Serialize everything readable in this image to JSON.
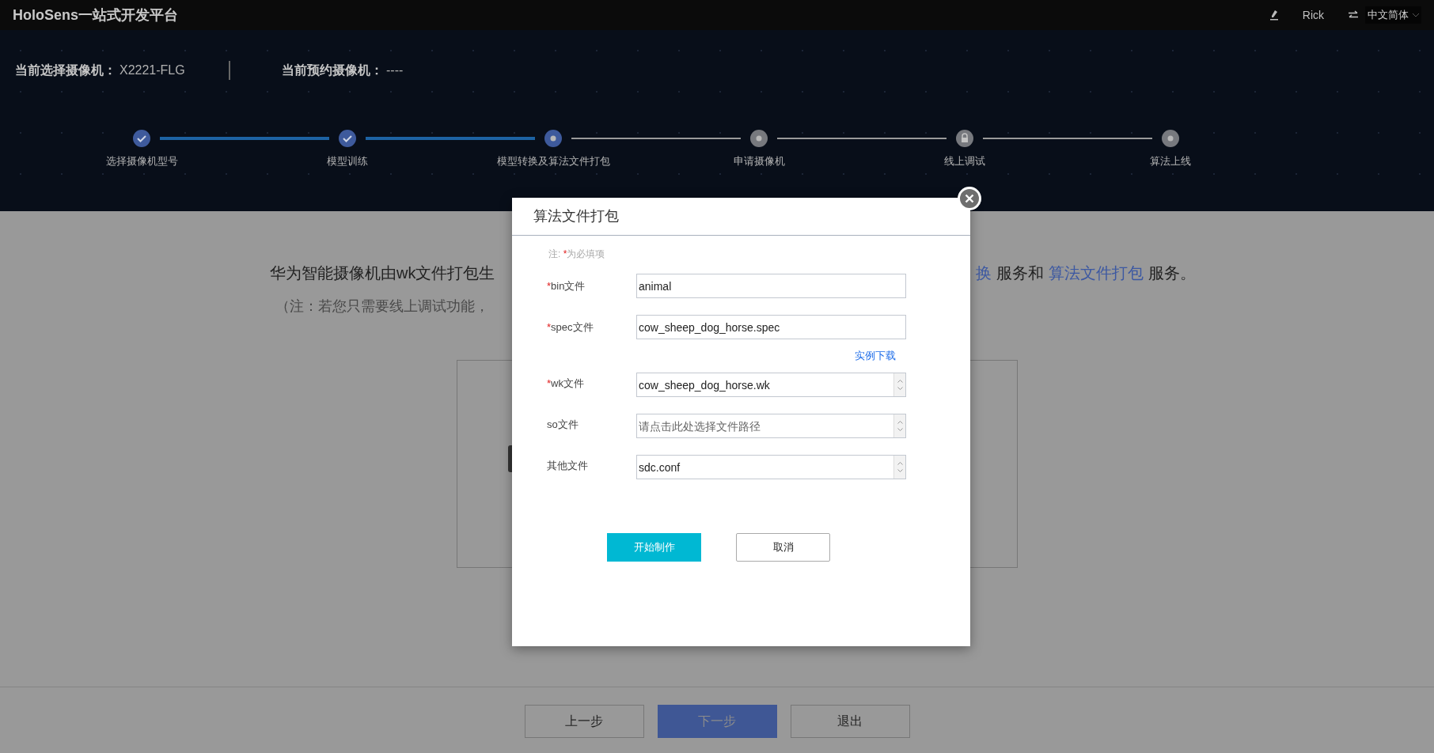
{
  "top_bar": {
    "title": "HoloSens一站式开发平台",
    "user": "Rick",
    "language": "中文简体"
  },
  "camera": {
    "selected_label": "当前选择摄像机：",
    "selected_value": "X2221-FLG",
    "reserved_label": "当前预约摄像机：",
    "reserved_value": "----"
  },
  "steps": [
    {
      "label": "选择摄像机型号",
      "kind": "done"
    },
    {
      "label": "模型训练",
      "kind": "done"
    },
    {
      "label": "模型转换及算法文件打包",
      "kind": "current"
    },
    {
      "label": "申请摄像机",
      "kind": "pending"
    },
    {
      "label": "线上调试",
      "kind": "locked"
    },
    {
      "label": "算法上线",
      "kind": "pending"
    }
  ],
  "intro": {
    "line_1_left": "华为智能摄像机由wk文件打包生",
    "line_1_right": [
      {
        "text": "换",
        "kind": "link"
      },
      {
        "text": "服务和",
        "kind": "plain"
      },
      {
        "text": "算法文件打包",
        "kind": "link"
      },
      {
        "text": "服务。",
        "kind": "plain"
      }
    ],
    "line_2_left": "（注：若您只需要线上调试功能，"
  },
  "dialog": {
    "title": "算法文件打包",
    "note_prefix": "注:",
    "note_mark": "*",
    "note_text": "为必填项",
    "fields": [
      {
        "label": "bin文件",
        "required_mark": "*",
        "kind": "text",
        "value": "animal"
      },
      {
        "label": "spec文件",
        "required_mark": "*",
        "kind": "text",
        "value": "cow_sheep_dog_horse.spec",
        "link": "实例下载"
      },
      {
        "label": "wk文件",
        "required_mark": "*",
        "kind": "file",
        "value": "cow_sheep_dog_horse.wk"
      },
      {
        "label": "so文件",
        "kind": "file",
        "placeholder": "请点击此处选择文件路径"
      },
      {
        "label": "其他文件",
        "kind": "file",
        "value": "sdc.conf"
      }
    ],
    "buttons": [
      {
        "label": "开始制作",
        "primary": true
      },
      {
        "label": "取消",
        "primary": false
      }
    ]
  },
  "footer_buttons": [
    {
      "label": "上一步",
      "primary": false
    },
    {
      "label": "下一步",
      "primary": true
    },
    {
      "label": "退出",
      "primary": false
    }
  ]
}
